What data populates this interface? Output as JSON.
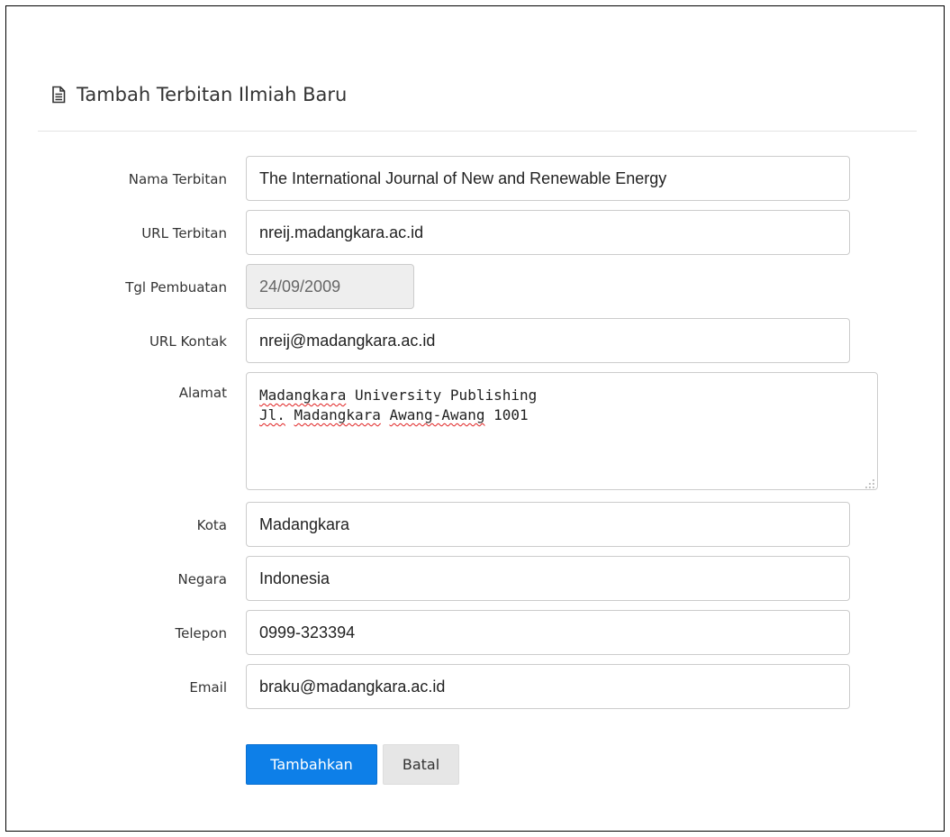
{
  "panel": {
    "title": "Tambah Terbitan Ilmiah Baru",
    "title_icon": "file-text-icon"
  },
  "form": {
    "nama_terbitan": {
      "label": "Nama Terbitan",
      "value": "The International Journal of New and Renewable Energy"
    },
    "url_terbitan": {
      "label": "URL Terbitan",
      "value": "nreij.madangkara.ac.id"
    },
    "tgl_pembuatan": {
      "label": "Tgl Pembuatan",
      "value": "24/09/2009"
    },
    "url_kontak": {
      "label": "URL Kontak",
      "value": "nreij@madangkara.ac.id"
    },
    "alamat": {
      "label": "Alamat",
      "line1_word1": "Madangkara",
      "line1_rest": " University Publishing",
      "line2_word1": "Jl.",
      "line2_space1": " ",
      "line2_word2": "Madangkara",
      "line2_space2": " ",
      "line2_word3": "Awang-Awang",
      "line2_rest": " 1001"
    },
    "kota": {
      "label": "Kota",
      "value": "Madangkara"
    },
    "negara": {
      "label": "Negara",
      "value": "Indonesia"
    },
    "telepon": {
      "label": "Telepon",
      "value": "0999-323394"
    },
    "email": {
      "label": "Email",
      "value": "braku@madangkara.ac.id"
    }
  },
  "actions": {
    "submit_label": "Tambahkan",
    "cancel_label": "Batal"
  },
  "colors": {
    "primary": "#0d7fe8",
    "disabled_bg": "#eeeeee",
    "spellcheck": "#e02020"
  }
}
